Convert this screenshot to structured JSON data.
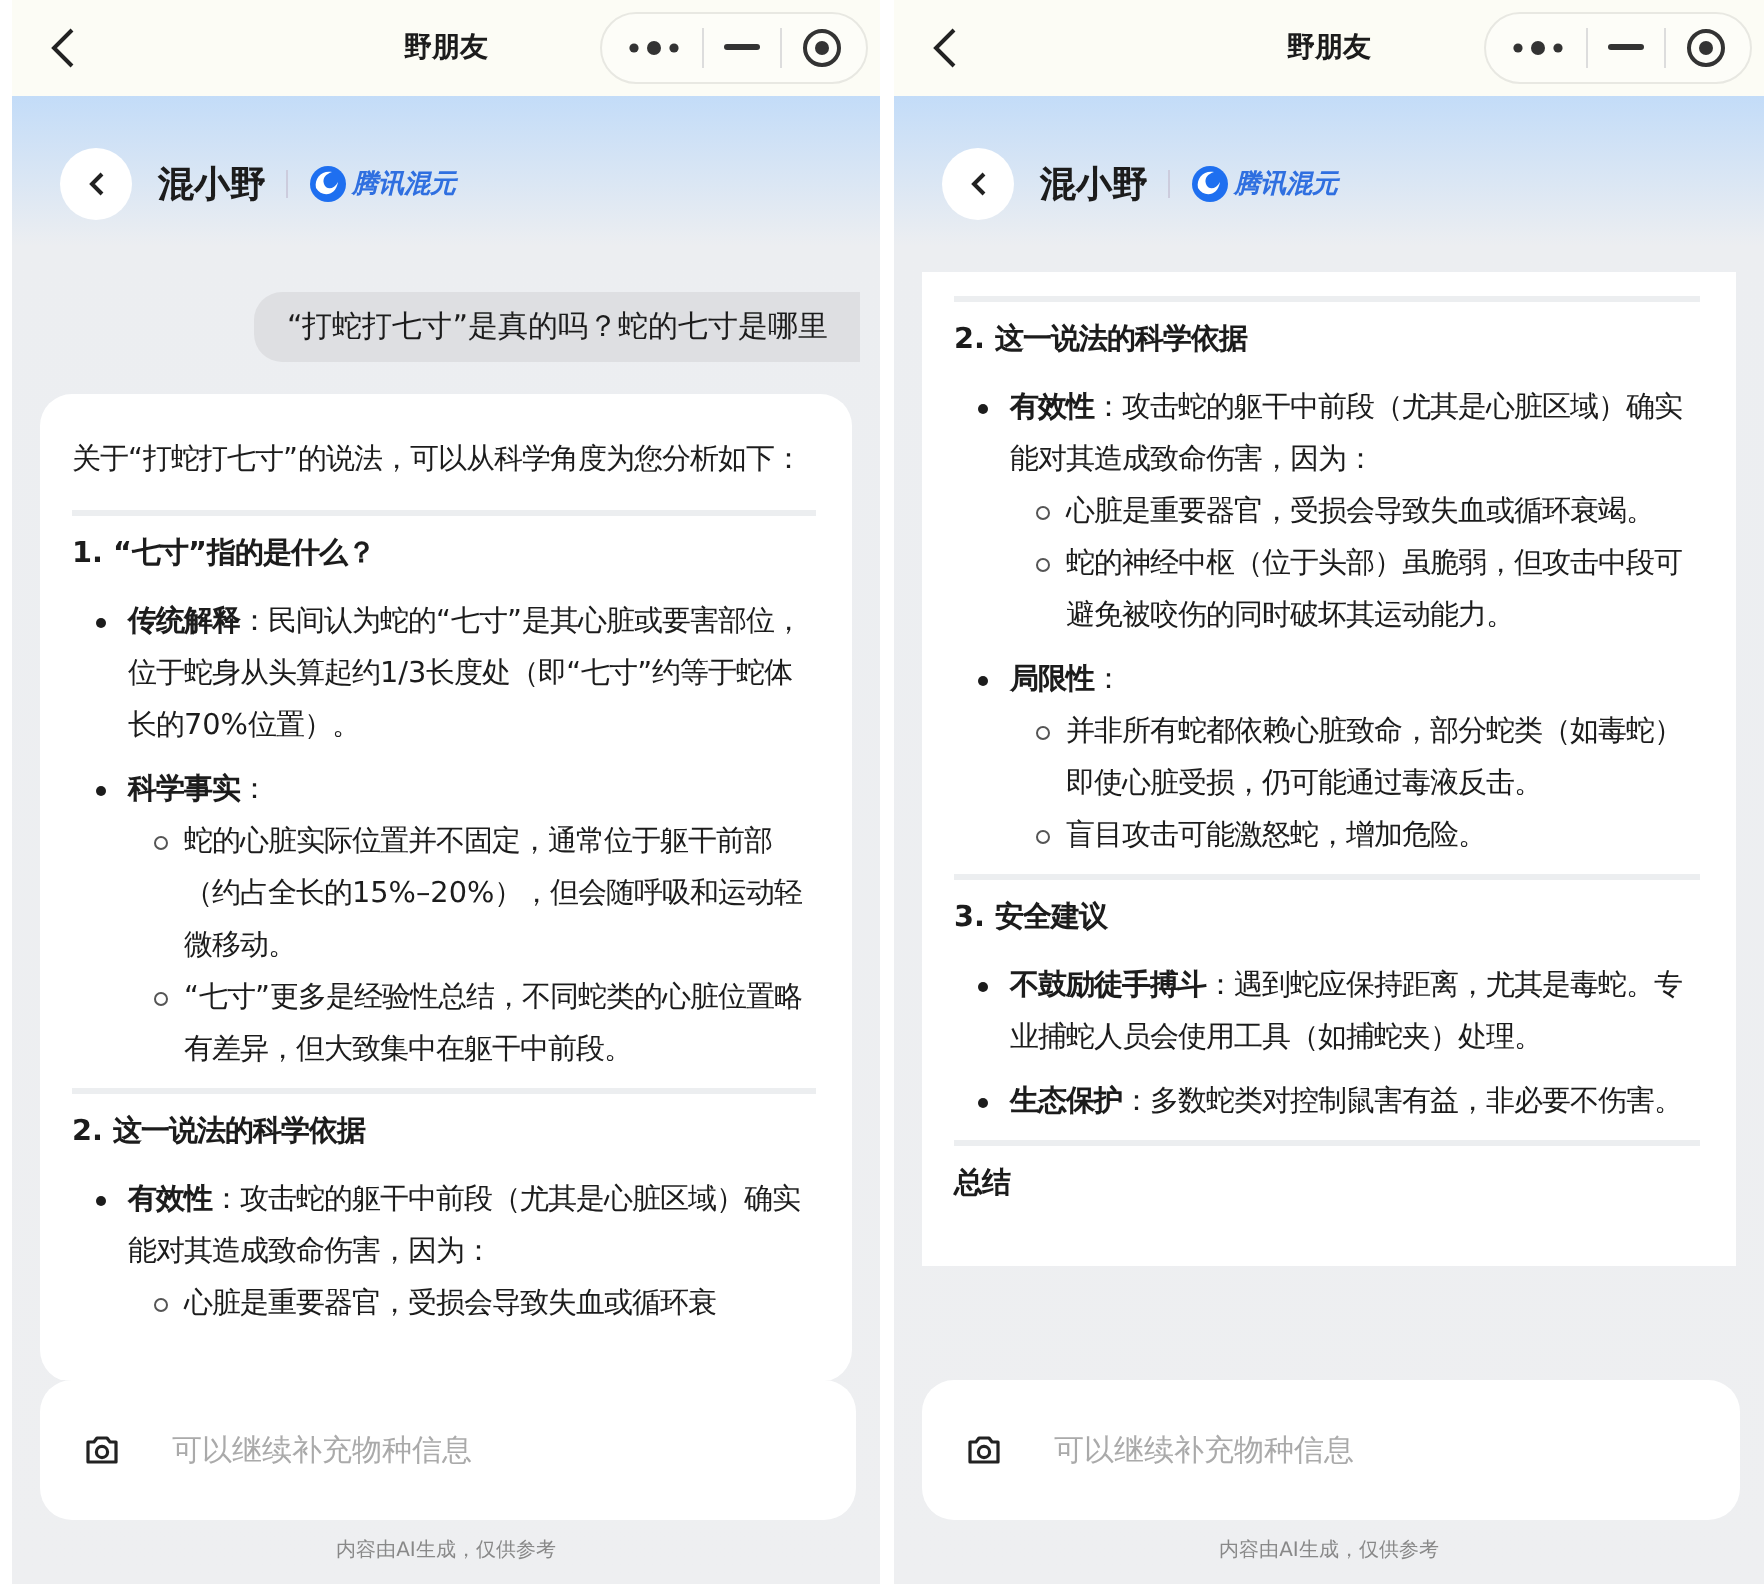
{
  "screens": [
    {
      "top_bar": {
        "title": "野朋友"
      },
      "header": {
        "name": "混小野",
        "brand": "腾讯混元"
      },
      "user_message": "“打蛇打七寸”是真的吗？蛇的七寸是哪里",
      "answer": [
        {
          "kind": "paragraph",
          "text": "关于“打蛇打七寸”的说法，可以从科学角度为您分析如下："
        },
        {
          "kind": "heading",
          "text": "1. “七寸”指的是什么？"
        },
        {
          "kind": "bullet",
          "text": "**传统解释**：民间认为蛇的“七寸”是其心脏或要害部位，位于蛇身从头算起约1/3长度处（即“七寸”约等于蛇体长的70%位置）。"
        },
        {
          "kind": "bullet",
          "text": "**科学事实**：",
          "children": [
            "蛇的心脏实际位置并不固定，通常位于躯干前部（约占全长的15%–20%），但会随呼吸和运动轻微移动。",
            "“七寸”更多是经验性总结，不同蛇类的心脏位置略有差异，但大致集中在躯干中前段。"
          ]
        },
        {
          "kind": "heading",
          "text": "2. 这一说法的科学依据"
        },
        {
          "kind": "bullet",
          "text": "**有效性**：攻击蛇的躯干中前段（尤其是心脏区域）确实能对其造成致命伤害，因为：",
          "children": [
            "心脏是重要器官，受损会导致失血或循环衰"
          ]
        }
      ],
      "input": {
        "placeholder": "可以继续补充物种信息"
      },
      "disclaimer": "内容由AI生成，仅供参考"
    },
    {
      "top_bar": {
        "title": "野朋友"
      },
      "header": {
        "name": "混小野",
        "brand": "腾讯混元"
      },
      "answer": [
        {
          "kind": "heading",
          "text": "2. 这一说法的科学依据"
        },
        {
          "kind": "bullet",
          "text": "**有效性**：攻击蛇的躯干中前段（尤其是心脏区域）确实能对其造成致命伤害，因为：",
          "children": [
            "心脏是重要器官，受损会导致失血或循环衰竭。",
            "蛇的神经中枢（位于头部）虽脆弱，但攻击中段可避免被咬伤的同时破坏其运动能力。"
          ]
        },
        {
          "kind": "bullet",
          "text": "**局限性**：",
          "children": [
            "并非所有蛇都依赖心脏致命，部分蛇类（如毒蛇）即使心脏受损，仍可能通过毒液反击。",
            "盲目攻击可能激怒蛇，增加危险。"
          ]
        },
        {
          "kind": "heading",
          "text": "3. 安全建议"
        },
        {
          "kind": "bullet",
          "text": "**不鼓励徒手搏斗**：遇到蛇应保持距离，尤其是毒蛇。专业捕蛇人员会使用工具（如捕蛇夹）处理。"
        },
        {
          "kind": "bullet",
          "text": "**生态保护**：多数蛇类对控制鼠害有益，非必要不伤害。"
        },
        {
          "kind": "heading",
          "text": "总结"
        }
      ],
      "input": {
        "placeholder": "可以继续补充物种信息"
      },
      "disclaimer": "内容由AI生成，仅供参考"
    }
  ]
}
